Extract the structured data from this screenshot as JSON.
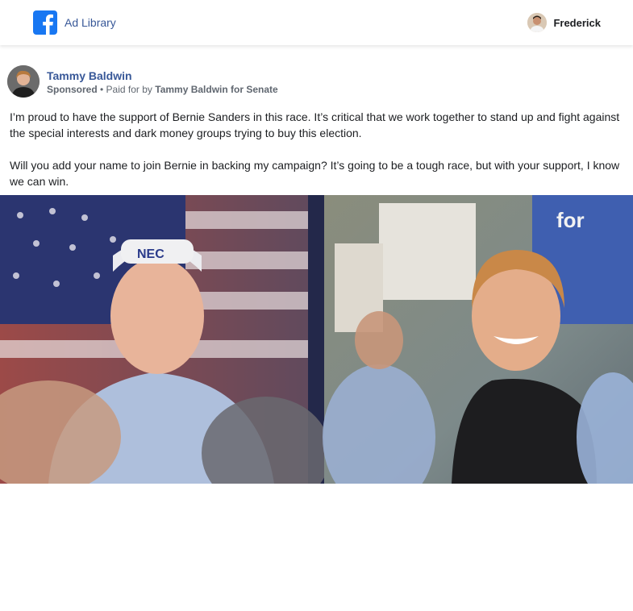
{
  "header": {
    "brand_label": "Ad Library",
    "user_name": "Frederick"
  },
  "ad": {
    "advertiser_name": "Tammy Baldwin",
    "sponsored_label": "Sponsored",
    "separator": " • ",
    "paid_for_prefix": "Paid for by ",
    "paid_for_by": "Tammy Baldwin for Senate",
    "body_paragraphs": [
      "I’m proud to have the support of Bernie Sanders in this race. It’s critical that we work together to stand up and fight against the special interests and dark money groups trying to buy this election.",
      "Will you add your name to join Bernie in backing my campaign? It’s going to be a tough race, but with your support, I know we can win."
    ],
    "image": {
      "left_panel": "Bernie Sanders smiling in front of an American flag",
      "right_panel": "Tammy Baldwin laughing at an outdoor rally with supporters holding signs"
    }
  },
  "colors": {
    "brand_blue": "#1877f2",
    "link_blue": "#385898",
    "text": "#1c1e21",
    "meta_text": "#606770"
  }
}
